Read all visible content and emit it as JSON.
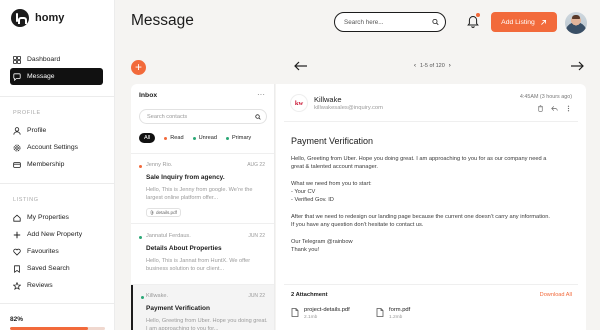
{
  "app": {
    "name": "homy"
  },
  "sidebar": {
    "items": [
      {
        "label": "Dashboard",
        "icon": "grid-icon"
      },
      {
        "label": "Message",
        "icon": "chat-icon",
        "active": true
      }
    ],
    "profile_label": "PROFILE",
    "profile_items": [
      {
        "label": "Profile",
        "icon": "user-icon"
      },
      {
        "label": "Account Settings",
        "icon": "settings-icon"
      },
      {
        "label": "Membership",
        "icon": "card-icon"
      }
    ],
    "listing_label": "LISTING",
    "listing_items": [
      {
        "label": "My Properties",
        "icon": "home-icon"
      },
      {
        "label": "Add New Property",
        "icon": "plus-icon"
      },
      {
        "label": "Favourites",
        "icon": "heart-icon"
      },
      {
        "label": "Saved Search",
        "icon": "bookmark-icon"
      },
      {
        "label": "Reviews",
        "icon": "star-icon"
      }
    ],
    "progress_label": "82%",
    "progress_value": 0.82
  },
  "header": {
    "title": "Message",
    "search_placeholder": "Search here...",
    "add_listing_label": "Add Listing",
    "accent": "#f26a3b"
  },
  "pager": {
    "text": "1-5 of 120"
  },
  "inbox": {
    "title": "Inbox",
    "search_placeholder": "Search contacts",
    "filters": [
      {
        "label": "All"
      },
      {
        "label": "Read",
        "color": "#f26a3b"
      },
      {
        "label": "Unread",
        "color": "#2aa876"
      },
      {
        "label": "Primary",
        "color": "#2aa876"
      }
    ],
    "mails": [
      {
        "from": "Jenny Rio.",
        "date": "AUG 22",
        "subject": "Sale Inquiry from agency.",
        "preview": "Hello, This is Jenny from google. We’re the largest online platform offer...",
        "attachment": "details.pdf",
        "dot": "#f26a3b"
      },
      {
        "from": "Jannatul Ferdaus.",
        "date": "JUN 22",
        "subject": "Details About Properties",
        "preview": "Hello, This is Jannat from HuntX. We offer business solution to our client...",
        "dot": "#2aa876"
      },
      {
        "from": "Killwake.",
        "date": "JUN 22",
        "subject": "Payment Verification",
        "preview": "Hello, Greeting from Uber. Hope you doing great. I am approaching to you for...",
        "dot": "#2aa876"
      }
    ]
  },
  "message": {
    "sender_logo": "kw",
    "sender_name": "Killwake",
    "sender_email": "killwakesales@inquiry.com",
    "time": "4:45AM (3 hours ago)",
    "subject": "Payment Verification",
    "body": {
      "p1": "Hello, Greeting from Uber. Hope you doing great. I am approaching to you for as our company need a great & talented account manager.",
      "p2_line1": "What we need from you to start:",
      "p2_line2": "- Your CV",
      "p2_line3": "- Verified Gov. ID",
      "p3": "After that we need to redesign our landing page because the current one doesn’t carry any information. If you have any question don’t hesitate to contact us.",
      "p4_line1": "Our Telegram @rainbow",
      "p4_line2": "Thank you!"
    },
    "attachments_title": "2 Attachment",
    "download_all": "Download All",
    "files": [
      {
        "name": "project-details.pdf",
        "size": "2.1mb"
      },
      {
        "name": "form.pdf",
        "size": "1.2mb"
      }
    ]
  }
}
